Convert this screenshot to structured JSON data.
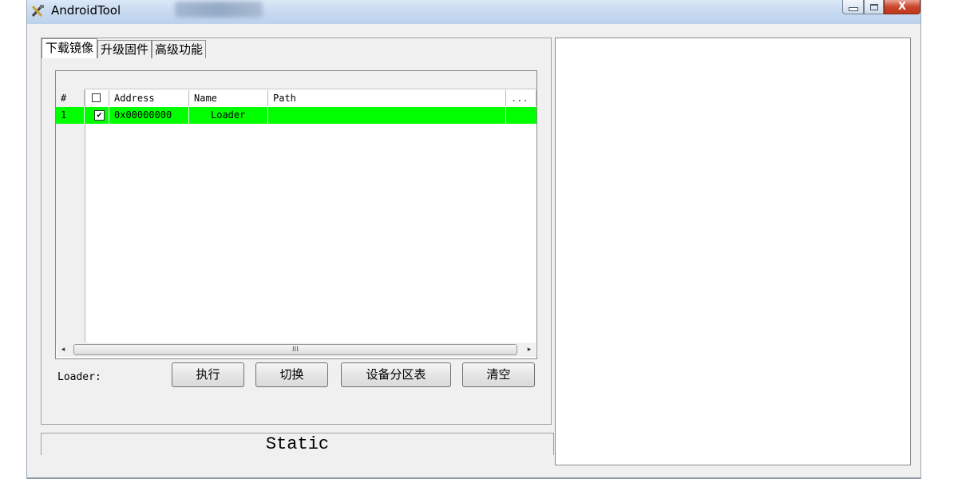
{
  "window": {
    "title": "AndroidTool",
    "minimize_label": "minimize",
    "maximize_label": "maximize",
    "close_symbol": "X"
  },
  "tabs": [
    {
      "label": "下载镜像",
      "active": true
    },
    {
      "label": "升级固件",
      "active": false
    },
    {
      "label": "高级功能",
      "active": false
    }
  ],
  "table": {
    "columns": [
      "#",
      "☐",
      "Address",
      "Name",
      "Path",
      "..."
    ],
    "rows": [
      {
        "index": "1",
        "checked": true,
        "check_mark": "✔",
        "address": "0x00000000",
        "name": "Loader",
        "path": "",
        "extra": ""
      }
    ],
    "row_highlight_color": "#00ff00",
    "scroll_thumb_grip": "III",
    "scroll_left_glyph": "◂",
    "scroll_right_glyph": "▸"
  },
  "loader_label": "Loader:",
  "buttons": {
    "execute": "执行",
    "switch": "切换",
    "device_partition": "设备分区表",
    "clear": "清空"
  },
  "status": "Static"
}
